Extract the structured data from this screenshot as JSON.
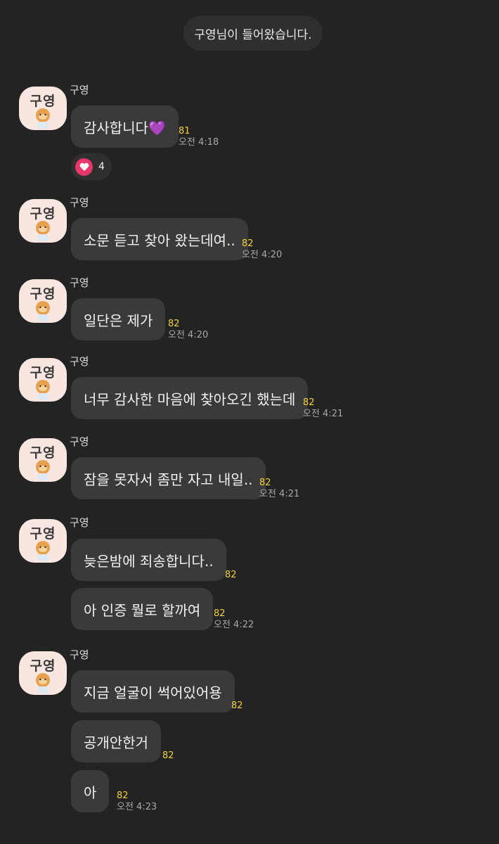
{
  "system_notice": "구영님이 들어왔습니다.",
  "avatar_text": "구영",
  "sender_name": "구영",
  "reaction": {
    "icon": "heart-icon",
    "count": "4",
    "color": "#e8386b"
  },
  "colors": {
    "background": "#232323",
    "bubble": "#3a3a3a",
    "unread": "#f5d23b",
    "avatar_bg": "#f9e6e0"
  },
  "messages": [
    {
      "text": "감사합니다💜",
      "unread": "81",
      "time": "오전 4:18"
    },
    {
      "text": "소문 듣고 찾아 왔는데여..",
      "unread": "82",
      "time": "오전 4:20"
    },
    {
      "text": "일단은 제가",
      "unread": "82",
      "time": "오전 4:20"
    },
    {
      "text": "너무 감사한 마음에 찾아오긴 했는데",
      "unread": "82",
      "time": "오전 4:21"
    },
    {
      "text": "잠을 못자서 좀만 자고 내일..",
      "unread": "82",
      "time": "오전 4:21"
    },
    {
      "text": "늦은밤에 죄송합니다..",
      "unread": "82"
    },
    {
      "text": "아 인증 뭘로 할까여",
      "unread": "82",
      "time": "오전 4:22"
    },
    {
      "text": "지금 얼굴이 썩어있어용",
      "unread": "82"
    },
    {
      "text": "공개안한거",
      "unread": "82"
    },
    {
      "text": "아",
      "unread": "82",
      "time": "오전 4:23"
    }
  ]
}
